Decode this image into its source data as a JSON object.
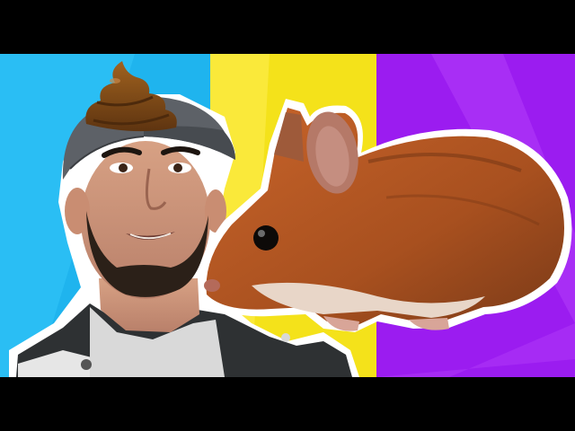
{
  "thumbnail": {
    "panels": [
      {
        "name": "panel-left",
        "color": "#1fb4ee",
        "accent": "#3fd0ff"
      },
      {
        "name": "panel-middle",
        "color": "#f4e21a",
        "accent": "#ffef5a"
      },
      {
        "name": "panel-right",
        "color": "#9b1cf0",
        "accent": "#c050ff"
      }
    ],
    "letterbox_color": "#000000",
    "subjects": [
      "man-with-cap",
      "poop-emoji-on-cap",
      "brown-mouse"
    ]
  }
}
